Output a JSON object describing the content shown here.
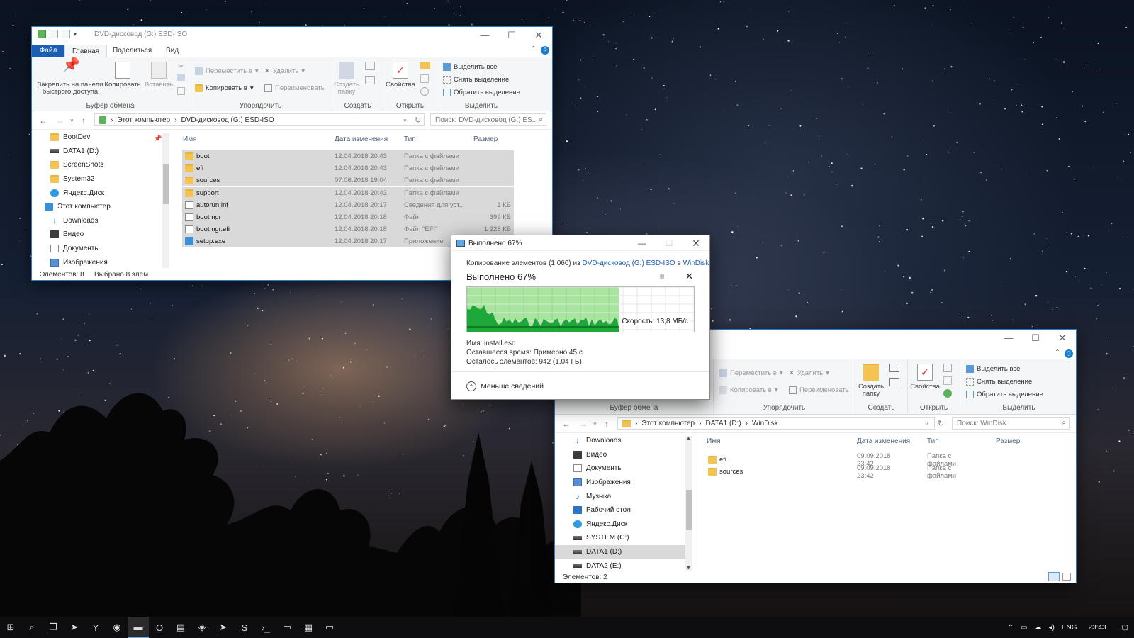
{
  "window1": {
    "title": "DVD-дисковод (G:) ESD-ISO",
    "tabs": [
      "Файл",
      "Главная",
      "Поделиться",
      "Вид"
    ],
    "ribbon": {
      "pin": "Закрепить на панели быстрого доступа",
      "copy": "Копировать",
      "paste": "Вставить",
      "clipboard": "Буфер обмена",
      "move_to": "Переместить в",
      "copy_to": "Копировать в",
      "delete": "Удалить",
      "rename": "Переименовать",
      "organize": "Упорядочить",
      "new_folder": "Создать папку",
      "create": "Создать",
      "properties": "Свойства",
      "open": "Открыть",
      "select_all": "Выделить все",
      "select_none": "Снять выделение",
      "invert_selection": "Обратить выделение",
      "select": "Выделить"
    },
    "address": [
      "Этот компьютер",
      "DVD-дисковод (G:) ESD-ISO"
    ],
    "search_placeholder": "Поиск: DVD-дисковод (G:) ES...",
    "nav_items": [
      {
        "label": "BootDev",
        "icon": "folder-icon"
      },
      {
        "label": "DATA1 (D:)",
        "icon": "drive-icon"
      },
      {
        "label": "ScreenShots",
        "icon": "folder-icon"
      },
      {
        "label": "System32",
        "icon": "folder-icon"
      },
      {
        "label": "Яндекс.Диск",
        "icon": "cloud-icon"
      },
      {
        "label": "Этот компьютер",
        "icon": "computer-icon"
      },
      {
        "label": "Downloads",
        "icon": "download-icon"
      },
      {
        "label": "Видео",
        "icon": "video-icon"
      },
      {
        "label": "Документы",
        "icon": "document-icon"
      },
      {
        "label": "Изображения",
        "icon": "pictures-icon"
      }
    ],
    "columns": [
      "Имя",
      "Дата изменения",
      "Тип",
      "Размер"
    ],
    "files": [
      {
        "name": "boot",
        "date": "12.04.2018 20:43",
        "type": "Папка с файлами",
        "size": "",
        "icon": "folder-icon"
      },
      {
        "name": "efi",
        "date": "12.04.2018 20:43",
        "type": "Папка с файлами",
        "size": "",
        "icon": "folder-icon"
      },
      {
        "name": "sources",
        "date": "07.06.2018 19:04",
        "type": "Папка с файлами",
        "size": "",
        "icon": "folder-icon"
      },
      {
        "name": "support",
        "date": "12.04.2018 20:43",
        "type": "Папка с файлами",
        "size": "",
        "icon": "folder-icon"
      },
      {
        "name": "autorun.inf",
        "date": "12.04.2018 20:17",
        "type": "Сведения для уст...",
        "size": "1 КБ",
        "icon": "settings-file-icon"
      },
      {
        "name": "bootmgr",
        "date": "12.04.2018 20:18",
        "type": "Файл",
        "size": "399 КБ",
        "icon": "file-icon"
      },
      {
        "name": "bootmgr.efi",
        "date": "12.04.2018 20:18",
        "type": "Файл \"EFI\"",
        "size": "1 228 КБ",
        "icon": "file-icon"
      },
      {
        "name": "setup.exe",
        "date": "12.04.2018 20:17",
        "type": "Приложение",
        "size": "",
        "icon": "setup-icon"
      }
    ],
    "status_count": "Элементов: 8",
    "status_selected": "Выбрано 8 элем."
  },
  "dialog": {
    "title": "Выполнено 67%",
    "copy_prefix": "Копирование элементов (1 060) из",
    "source": "DVD-дисковод (G:) ESD-ISO",
    "in_word": "в",
    "destination": "WinDisk",
    "progress_text": "Выполнено 67%",
    "progress": 0.67,
    "speed": "Скорость: 13,8 МБ/с",
    "name_line": "Имя:  install.esd",
    "time_line": "Оставшееся время:  Примерно 45 с",
    "items_line": "Осталось элементов:  942 (1,04 ГБ)",
    "less_details": "Меньше сведений",
    "colors": {
      "graph_fill": "#1fa83a",
      "graph_bg": "#a8e6a0"
    }
  },
  "window2": {
    "ribbon": {
      "move_to": "Переместить в",
      "copy_to": "Копировать в",
      "delete": "Удалить",
      "rename": "Переименовать",
      "new_folder": "Создать папку",
      "properties": "Свойства",
      "select_all": "Выделить все",
      "select_none": "Снять выделение",
      "invert_selection": "Обратить выделение",
      "clipboard": "Буфер обмена",
      "organize": "Упорядочить",
      "create": "Создать",
      "open": "Открыть",
      "select": "Выделить"
    },
    "address": [
      "Этот компьютер",
      "DATA1 (D:)",
      "WinDisk"
    ],
    "search_placeholder": "Поиск: WinDisk",
    "nav_items": [
      {
        "label": "Downloads",
        "icon": "download-icon"
      },
      {
        "label": "Видео",
        "icon": "video-icon"
      },
      {
        "label": "Документы",
        "icon": "document-icon"
      },
      {
        "label": "Изображения",
        "icon": "pictures-icon"
      },
      {
        "label": "Музыка",
        "icon": "music-icon"
      },
      {
        "label": "Рабочий стол",
        "icon": "desktop-icon"
      },
      {
        "label": "Яндекс.Диск",
        "icon": "cloud-icon"
      },
      {
        "label": "SYSTEM (C:)",
        "icon": "drive-icon"
      },
      {
        "label": "DATA1 (D:)",
        "icon": "drive-icon"
      },
      {
        "label": "DATA2 (E:)",
        "icon": "drive-icon"
      }
    ],
    "selected_nav": 8,
    "columns": [
      "Имя",
      "Дата изменения",
      "Тип",
      "Размер"
    ],
    "files": [
      {
        "name": "efi",
        "date": "09.09.2018 23:42",
        "type": "Папка с файлами",
        "icon": "folder-icon"
      },
      {
        "name": "sources",
        "date": "09.09.2018 23:42",
        "type": "Папка с файлами",
        "icon": "folder-icon"
      }
    ],
    "status_count": "Элементов: 2"
  },
  "taskbar": {
    "icons": [
      "windows-start-icon",
      "search-icon",
      "task-view-icon",
      "telegram-icon",
      "yandex-icon",
      "chrome-icon",
      "explorer-icon",
      "opera-icon",
      "app-icon",
      "box-icon",
      "telegram-icon",
      "sublime-icon",
      "powershell-icon",
      "terminal-icon",
      "calculator-icon",
      "terminal-icon"
    ],
    "lang": "ENG",
    "time": "23:43"
  }
}
